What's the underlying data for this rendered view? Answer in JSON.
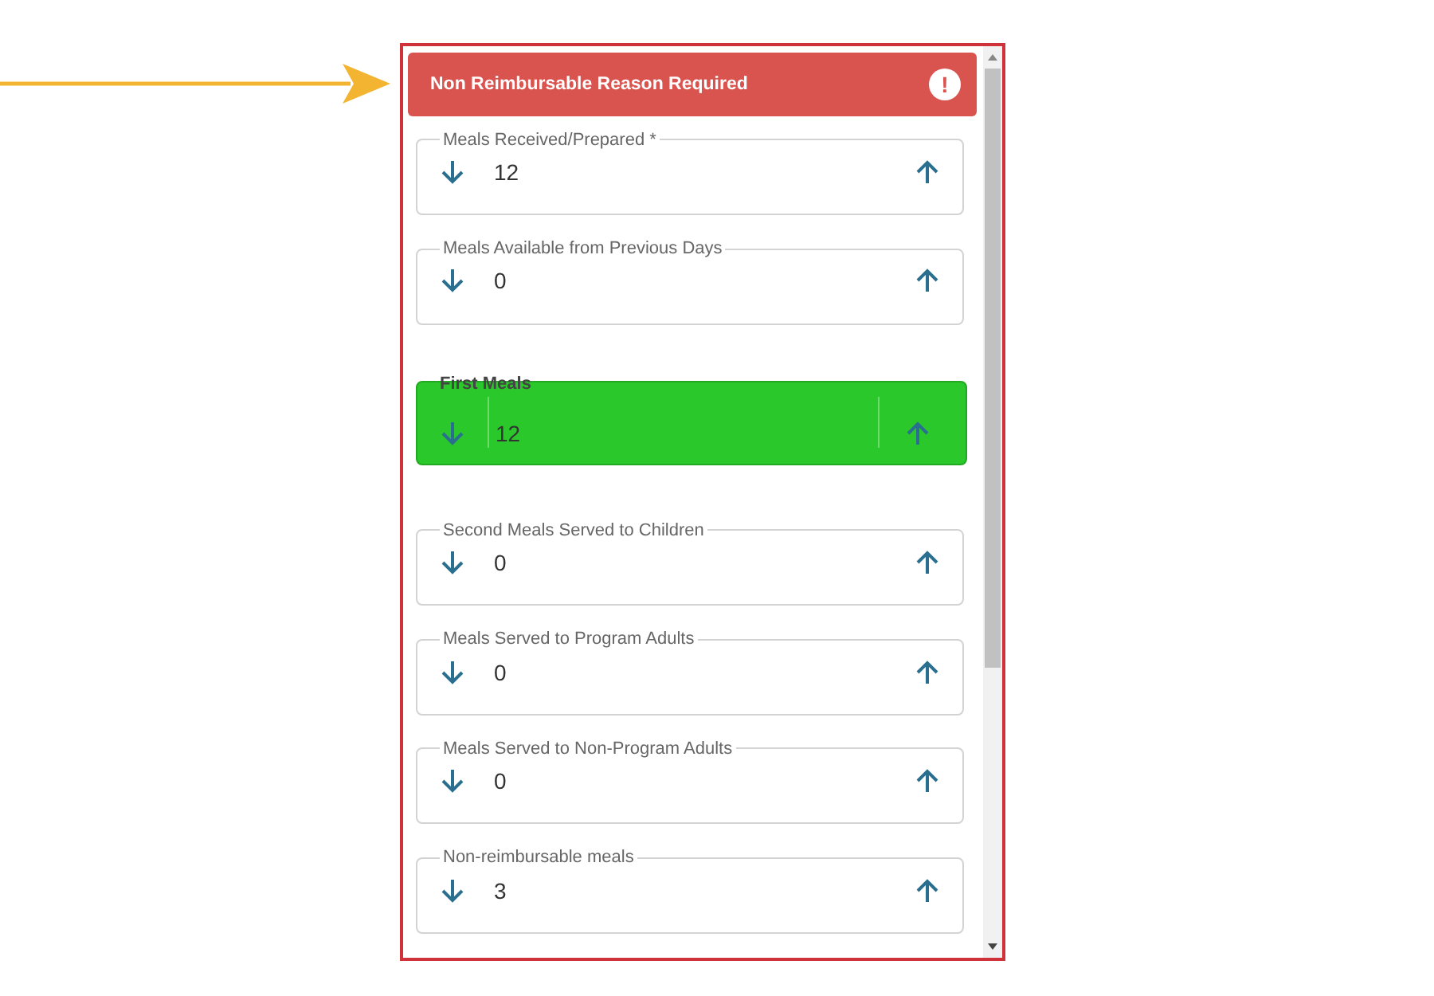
{
  "alert": {
    "message": "Non Reimbursable Reason Required",
    "icon": "!"
  },
  "fields": [
    {
      "label": "Meals Received/Prepared *",
      "value": "12",
      "highlighted": false
    },
    {
      "label": "Meals Available from Previous Days",
      "value": "0",
      "highlighted": false
    },
    {
      "label": "First Meals",
      "value": "12",
      "highlighted": true
    },
    {
      "label": "Second Meals Served to Children",
      "value": "0",
      "highlighted": false
    },
    {
      "label": "Meals Served to Program Adults",
      "value": "0",
      "highlighted": false
    },
    {
      "label": "Meals Served to Non-Program Adults",
      "value": "0",
      "highlighted": false
    },
    {
      "label": "Non-reimbursable meals",
      "value": "3",
      "highlighted": false
    }
  ]
}
